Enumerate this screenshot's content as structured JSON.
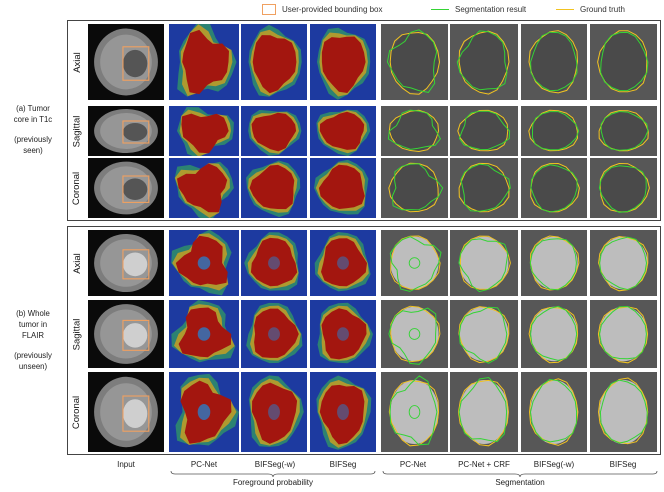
{
  "legend": {
    "bbox_label": "User-provided bounding box",
    "seg_label": "Segmentation result",
    "gt_label": "Ground truth",
    "bbox_color": "#f0a060",
    "seg_color": "#35d435",
    "gt_color": "#f2c320"
  },
  "sections": [
    {
      "label_lines": [
        "(a) Tumor",
        "core in T1c",
        "",
        "(previously",
        "seen)"
      ],
      "rows": [
        "Axial",
        "Sagittal",
        "Coronal"
      ]
    },
    {
      "label_lines": [
        "(b) Whole",
        "tumor in",
        "FLAIR",
        "",
        "(previously",
        "unseen)"
      ],
      "rows": [
        "Axial",
        "Sagittal",
        "Coronal"
      ]
    }
  ],
  "columns": [
    "Input",
    "PC-Net",
    "BIFSeg(-w)",
    "BIFSeg",
    "PC-Net",
    "PC-Net  + CRF",
    "BIFSeg(-w)",
    "BIFSeg"
  ],
  "groups": {
    "probability": "Foreground probability",
    "segmentation": "Segmentation"
  },
  "colors": {
    "prob_background": "#1d3aa0",
    "prob_hot": "#a3160f",
    "frame": "#444444"
  }
}
